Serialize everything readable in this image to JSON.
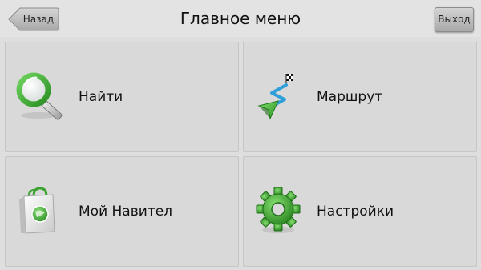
{
  "header": {
    "title": "Главное меню",
    "back_label": "Назад",
    "exit_label": "Выход"
  },
  "menu": {
    "items": [
      {
        "label": "Найти",
        "icon": "magnifier-icon"
      },
      {
        "label": "Маршрут",
        "icon": "route-icon"
      },
      {
        "label": "Мой Навител",
        "icon": "shopping-bag-icon"
      },
      {
        "label": "Настройки",
        "icon": "gear-icon"
      }
    ]
  },
  "colors": {
    "background": "#dedede",
    "tile": "#d9d9d9",
    "icon_green": "#3aa32f",
    "route_blue": "#2f9fd9"
  }
}
